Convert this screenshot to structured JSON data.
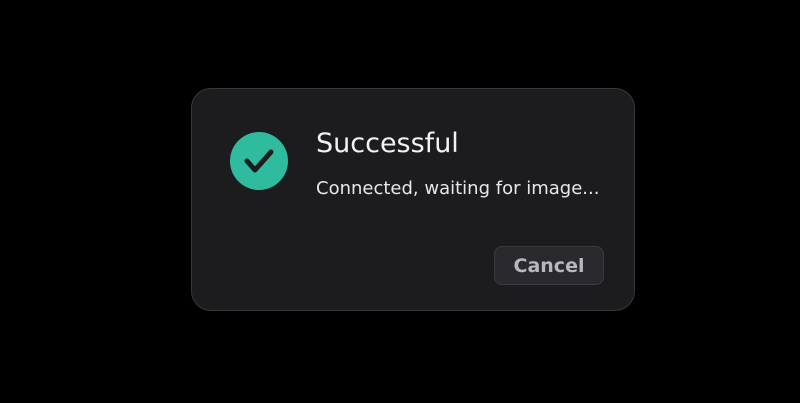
{
  "dialog": {
    "title": "Successful",
    "message": "Connected, waiting for image...",
    "icon": "check-circle-icon",
    "icon_color": "#2fbb9e",
    "cancel_label": "Cancel"
  }
}
